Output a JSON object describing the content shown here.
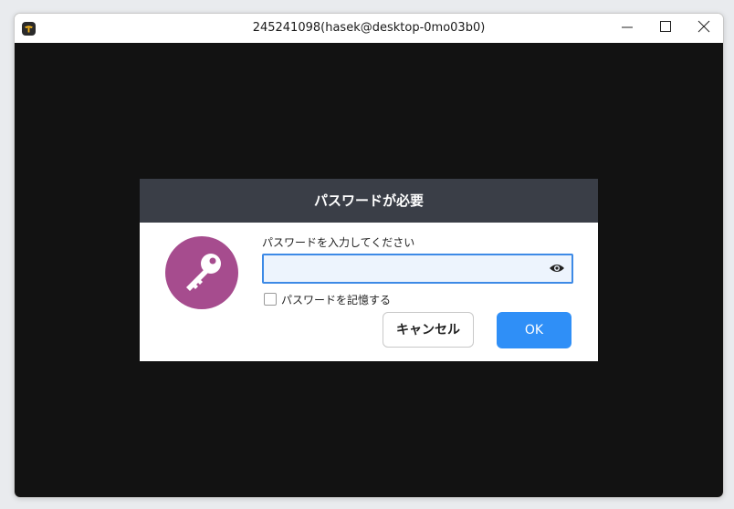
{
  "window": {
    "title": "245241098(hasek@desktop-0mo03b0)",
    "app_icon": "app-icon",
    "controls": {
      "minimize_icon": "minimize-icon",
      "maximize_icon": "maximize-icon",
      "close_icon": "close-icon"
    }
  },
  "dialog": {
    "title": "パスワードが必要",
    "icon": "key-icon",
    "password_label": "パスワードを入力してください",
    "password_value": "",
    "show_password_icon": "eye-icon",
    "remember_label": "パスワードを記憶する",
    "remember_checked": false,
    "cancel_label": "キャンセル",
    "ok_label": "OK"
  },
  "colors": {
    "dialog_header": "#3a3e47",
    "key_badge": "#a64c8e",
    "ok_button": "#2f8ff7",
    "input_border": "#3d8ae6",
    "background": "#121212"
  }
}
